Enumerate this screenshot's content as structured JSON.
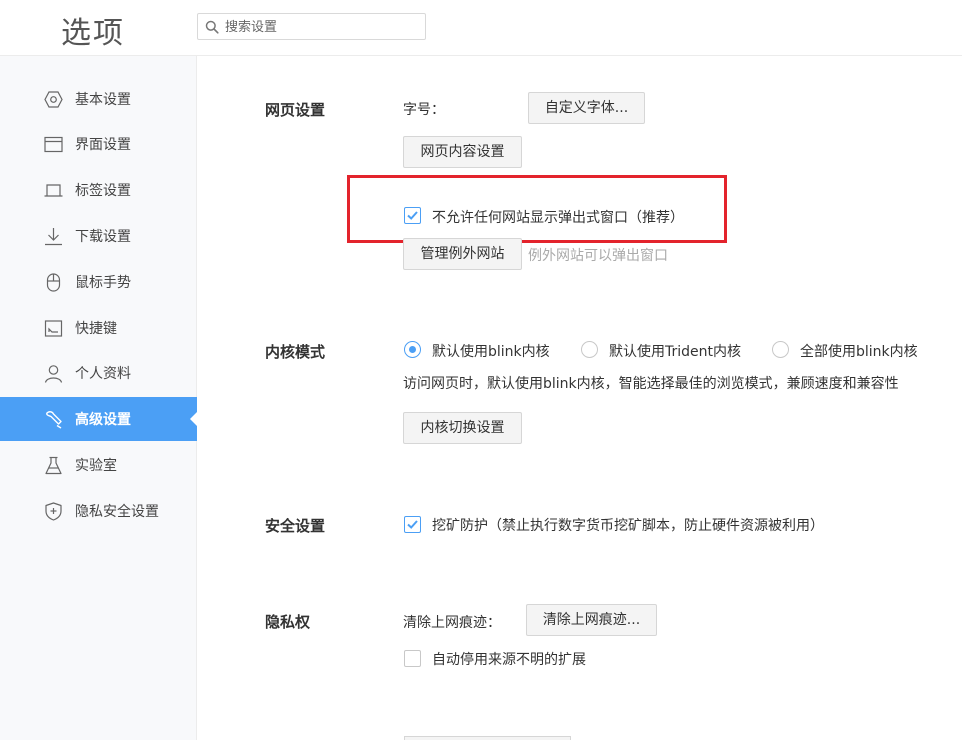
{
  "header": {
    "title": "选项",
    "search_placeholder": "搜索设置"
  },
  "sidebar": {
    "items": [
      {
        "label": "基本设置",
        "icon": "hexagon-icon"
      },
      {
        "label": "界面设置",
        "icon": "window-icon"
      },
      {
        "label": "标签设置",
        "icon": "tab-icon"
      },
      {
        "label": "下载设置",
        "icon": "download-icon"
      },
      {
        "label": "鼠标手势",
        "icon": "mouse-icon"
      },
      {
        "label": "快捷键",
        "icon": "shortcut-icon"
      },
      {
        "label": "个人资料",
        "icon": "user-icon"
      },
      {
        "label": "高级设置",
        "icon": "wrench-icon",
        "active": true
      },
      {
        "label": "实验室",
        "icon": "flask-icon"
      },
      {
        "label": "隐私安全设置",
        "icon": "shield-icon"
      }
    ]
  },
  "web_settings": {
    "title": "网页设置",
    "font_label": "字号：",
    "custom_font_button": "自定义字体...",
    "content_settings_button": "网页内容设置",
    "block_popups_label": "不允许任何网站显示弹出式窗口（推荐）",
    "block_popups_checked": true,
    "manage_exceptions_button": "管理例外网站",
    "exceptions_hint": "例外网站可以弹出窗口"
  },
  "kernel": {
    "title": "内核模式",
    "options": [
      {
        "label": "默认使用blink内核",
        "selected": true
      },
      {
        "label": "默认使用Trident内核",
        "selected": false
      },
      {
        "label": "全部使用blink内核",
        "selected": false
      }
    ],
    "description": "访问网页时，默认使用blink内核，智能选择最佳的浏览模式，兼顾速度和兼容性",
    "switch_button": "内核切换设置"
  },
  "security": {
    "title": "安全设置",
    "mining_label": "挖矿防护（禁止执行数字货币挖矿脚本，防止硬件资源被利用）",
    "mining_checked": true
  },
  "privacy": {
    "title": "隐私权",
    "clear_label": "清除上网痕迹：",
    "clear_button": "清除上网痕迹...",
    "auto_disable_label": "自动停用来源不明的扩展",
    "auto_disable_checked": false
  },
  "colors": {
    "accent": "#4b9ff5",
    "highlight_box": "#e3232c"
  }
}
